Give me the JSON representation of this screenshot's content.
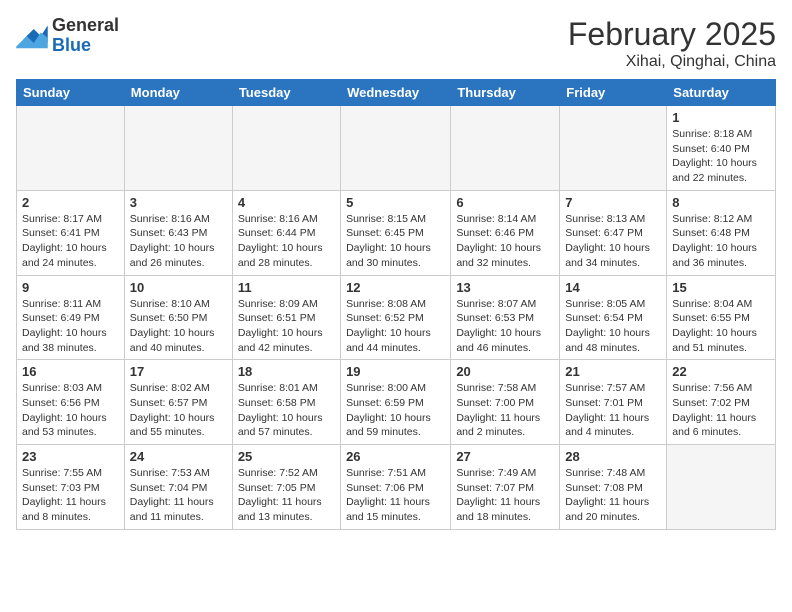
{
  "header": {
    "logo_line1": "General",
    "logo_line2": "Blue",
    "title": "February 2025",
    "subtitle": "Xihai, Qinghai, China"
  },
  "weekdays": [
    "Sunday",
    "Monday",
    "Tuesday",
    "Wednesday",
    "Thursday",
    "Friday",
    "Saturday"
  ],
  "weeks": [
    [
      {
        "day": null
      },
      {
        "day": null
      },
      {
        "day": null
      },
      {
        "day": null
      },
      {
        "day": null
      },
      {
        "day": null
      },
      {
        "day": 1,
        "sunrise": "8:18 AM",
        "sunset": "6:40 PM",
        "daylight": "10 hours and 22 minutes."
      }
    ],
    [
      {
        "day": 2,
        "sunrise": "8:17 AM",
        "sunset": "6:41 PM",
        "daylight": "10 hours and 24 minutes."
      },
      {
        "day": 3,
        "sunrise": "8:16 AM",
        "sunset": "6:43 PM",
        "daylight": "10 hours and 26 minutes."
      },
      {
        "day": 4,
        "sunrise": "8:16 AM",
        "sunset": "6:44 PM",
        "daylight": "10 hours and 28 minutes."
      },
      {
        "day": 5,
        "sunrise": "8:15 AM",
        "sunset": "6:45 PM",
        "daylight": "10 hours and 30 minutes."
      },
      {
        "day": 6,
        "sunrise": "8:14 AM",
        "sunset": "6:46 PM",
        "daylight": "10 hours and 32 minutes."
      },
      {
        "day": 7,
        "sunrise": "8:13 AM",
        "sunset": "6:47 PM",
        "daylight": "10 hours and 34 minutes."
      },
      {
        "day": 8,
        "sunrise": "8:12 AM",
        "sunset": "6:48 PM",
        "daylight": "10 hours and 36 minutes."
      }
    ],
    [
      {
        "day": 9,
        "sunrise": "8:11 AM",
        "sunset": "6:49 PM",
        "daylight": "10 hours and 38 minutes."
      },
      {
        "day": 10,
        "sunrise": "8:10 AM",
        "sunset": "6:50 PM",
        "daylight": "10 hours and 40 minutes."
      },
      {
        "day": 11,
        "sunrise": "8:09 AM",
        "sunset": "6:51 PM",
        "daylight": "10 hours and 42 minutes."
      },
      {
        "day": 12,
        "sunrise": "8:08 AM",
        "sunset": "6:52 PM",
        "daylight": "10 hours and 44 minutes."
      },
      {
        "day": 13,
        "sunrise": "8:07 AM",
        "sunset": "6:53 PM",
        "daylight": "10 hours and 46 minutes."
      },
      {
        "day": 14,
        "sunrise": "8:05 AM",
        "sunset": "6:54 PM",
        "daylight": "10 hours and 48 minutes."
      },
      {
        "day": 15,
        "sunrise": "8:04 AM",
        "sunset": "6:55 PM",
        "daylight": "10 hours and 51 minutes."
      }
    ],
    [
      {
        "day": 16,
        "sunrise": "8:03 AM",
        "sunset": "6:56 PM",
        "daylight": "10 hours and 53 minutes."
      },
      {
        "day": 17,
        "sunrise": "8:02 AM",
        "sunset": "6:57 PM",
        "daylight": "10 hours and 55 minutes."
      },
      {
        "day": 18,
        "sunrise": "8:01 AM",
        "sunset": "6:58 PM",
        "daylight": "10 hours and 57 minutes."
      },
      {
        "day": 19,
        "sunrise": "8:00 AM",
        "sunset": "6:59 PM",
        "daylight": "10 hours and 59 minutes."
      },
      {
        "day": 20,
        "sunrise": "7:58 AM",
        "sunset": "7:00 PM",
        "daylight": "11 hours and 2 minutes."
      },
      {
        "day": 21,
        "sunrise": "7:57 AM",
        "sunset": "7:01 PM",
        "daylight": "11 hours and 4 minutes."
      },
      {
        "day": 22,
        "sunrise": "7:56 AM",
        "sunset": "7:02 PM",
        "daylight": "11 hours and 6 minutes."
      }
    ],
    [
      {
        "day": 23,
        "sunrise": "7:55 AM",
        "sunset": "7:03 PM",
        "daylight": "11 hours and 8 minutes."
      },
      {
        "day": 24,
        "sunrise": "7:53 AM",
        "sunset": "7:04 PM",
        "daylight": "11 hours and 11 minutes."
      },
      {
        "day": 25,
        "sunrise": "7:52 AM",
        "sunset": "7:05 PM",
        "daylight": "11 hours and 13 minutes."
      },
      {
        "day": 26,
        "sunrise": "7:51 AM",
        "sunset": "7:06 PM",
        "daylight": "11 hours and 15 minutes."
      },
      {
        "day": 27,
        "sunrise": "7:49 AM",
        "sunset": "7:07 PM",
        "daylight": "11 hours and 18 minutes."
      },
      {
        "day": 28,
        "sunrise": "7:48 AM",
        "sunset": "7:08 PM",
        "daylight": "11 hours and 20 minutes."
      },
      {
        "day": null
      }
    ]
  ]
}
